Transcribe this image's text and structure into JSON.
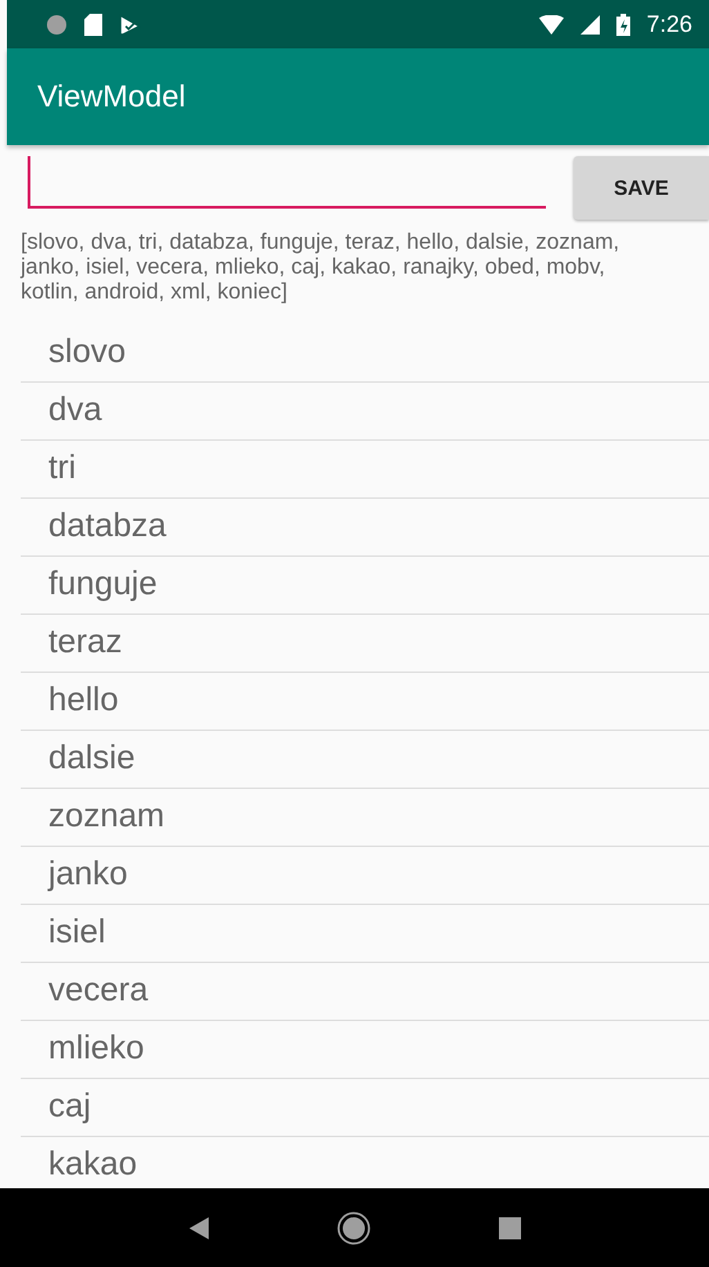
{
  "status_bar": {
    "time": "7:26"
  },
  "app_bar": {
    "title": "ViewModel"
  },
  "input": {
    "focused": true
  },
  "save_button": "SAVE",
  "summary": "[slovo, dva, tri, databza, funguje, teraz, hello, dalsie, zoznam, janko, isiel, vecera, mlieko, caj, kakao, ranajky, obed, mobv, kotlin, android, xml, koniec]",
  "items": [
    "slovo",
    "dva",
    "tri",
    "databza",
    "funguje",
    "teraz",
    "hello",
    "dalsie",
    "zoznam",
    "janko",
    "isiel",
    "vecera",
    "mlieko",
    "caj",
    "kakao"
  ]
}
